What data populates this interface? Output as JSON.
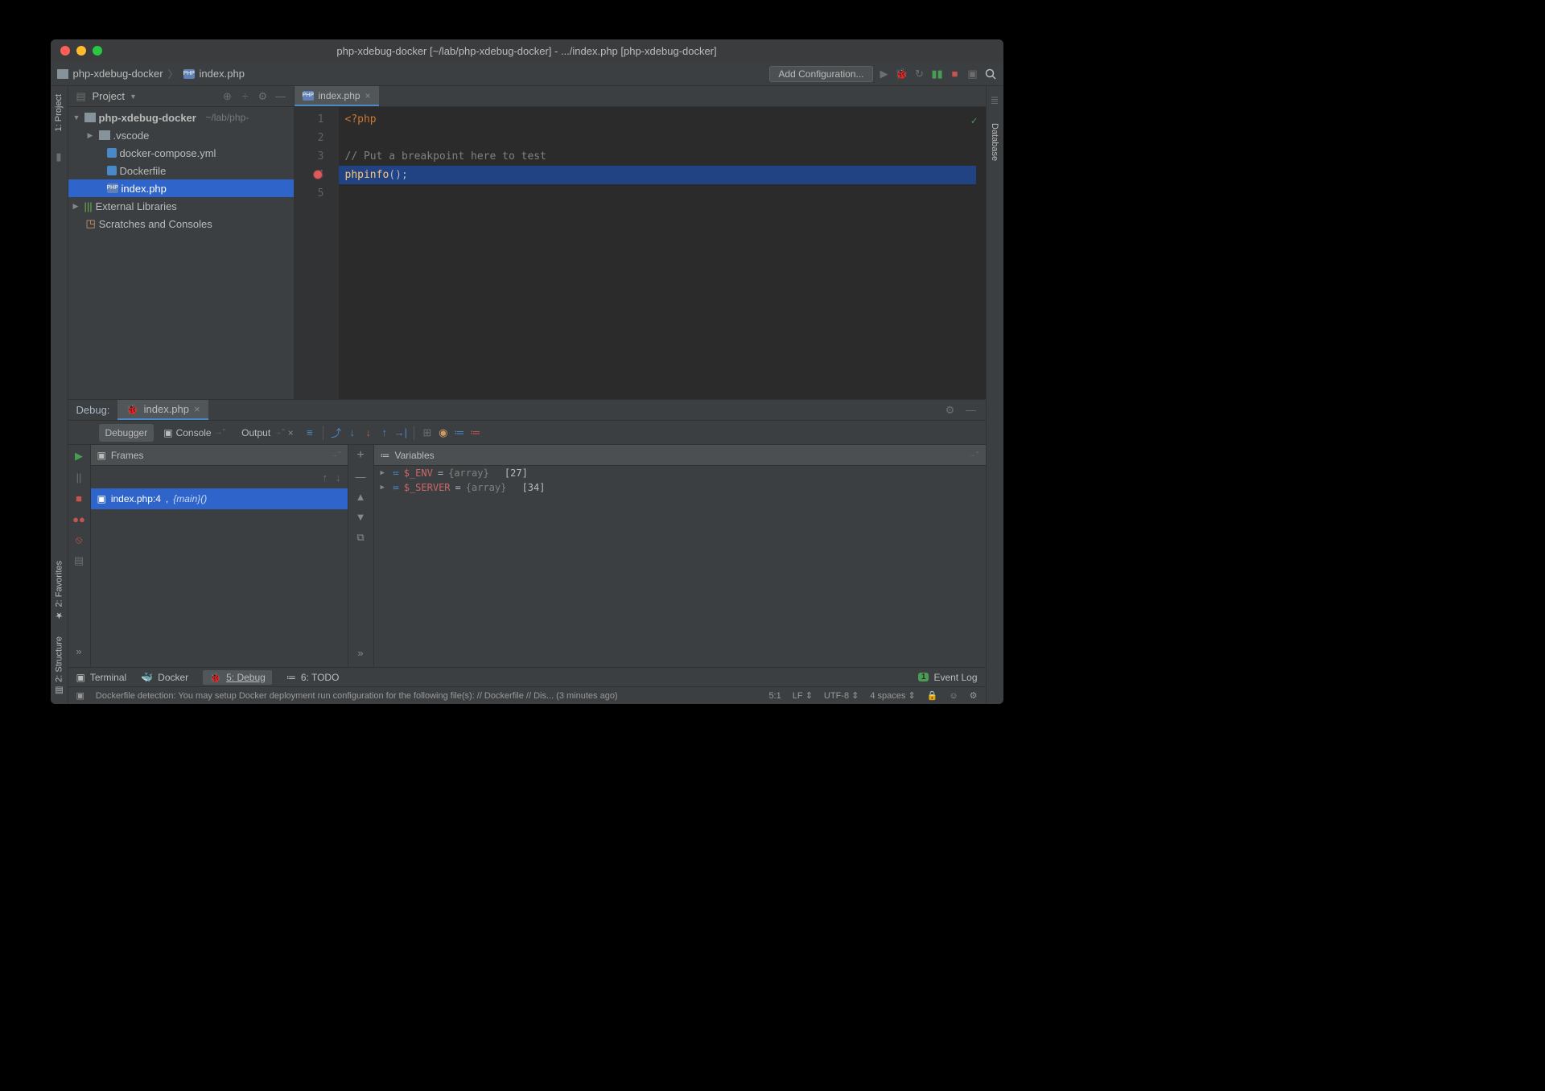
{
  "window": {
    "title": "php-xdebug-docker [~/lab/php-xdebug-docker] - .../index.php [php-xdebug-docker]"
  },
  "navbar": {
    "project": "php-xdebug-docker",
    "file": "index.php",
    "addConfig": "Add Configuration..."
  },
  "sidebar": {
    "title": "Project",
    "root": "php-xdebug-docker",
    "rootPath": "~/lab/php-",
    "items": [
      {
        "name": ".vscode",
        "type": "folder"
      },
      {
        "name": "docker-compose.yml",
        "type": "file"
      },
      {
        "name": "Dockerfile",
        "type": "file"
      },
      {
        "name": "index.php",
        "type": "php",
        "selected": true
      }
    ],
    "external": "External Libraries",
    "scratches": "Scratches and Consoles"
  },
  "leftRail": {
    "item1": "1: Project"
  },
  "rightRail": {
    "item1": "Database"
  },
  "editor": {
    "tab": "index.php",
    "lines": [
      {
        "n": 1,
        "html": "<span class='kw'>&lt;?php</span>"
      },
      {
        "n": 2,
        "html": ""
      },
      {
        "n": 3,
        "html": "<span class='cm'>// Put a breakpoint here to test</span>"
      },
      {
        "n": 4,
        "html": "<span class='fn'>phpinfo</span><span class='pn'>();</span>",
        "breakpoint": true,
        "highlight": true
      },
      {
        "n": 5,
        "html": ""
      }
    ]
  },
  "debug": {
    "label": "Debug:",
    "tabName": "index.php",
    "tabs": {
      "debugger": "Debugger",
      "console": "Console",
      "output": "Output"
    },
    "frames": {
      "title": "Frames",
      "row": {
        "file": "index.php:4",
        "func": "{main}()"
      }
    },
    "variables": {
      "title": "Variables",
      "rows": [
        {
          "name": "$_ENV",
          "eq": " = ",
          "type": "{array}",
          "count": "[27]"
        },
        {
          "name": "$_SERVER",
          "eq": " = ",
          "type": "{array}",
          "count": "[34]"
        }
      ]
    }
  },
  "footerTabs": {
    "terminal": "Terminal",
    "docker": "Docker",
    "debug": "5: Debug",
    "todo": "6: TODO",
    "eventLog": "Event Log"
  },
  "statusbar": {
    "msg": "Dockerfile detection: You may setup Docker deployment run configuration for the following file(s): // Dockerfile // Dis... (3 minutes ago)",
    "pos": "5:1",
    "le": "LF",
    "enc": "UTF-8",
    "indent": "4 spaces"
  },
  "leftRailBottom": {
    "fav": "2: Favorites",
    "struct": "2: Structure"
  }
}
